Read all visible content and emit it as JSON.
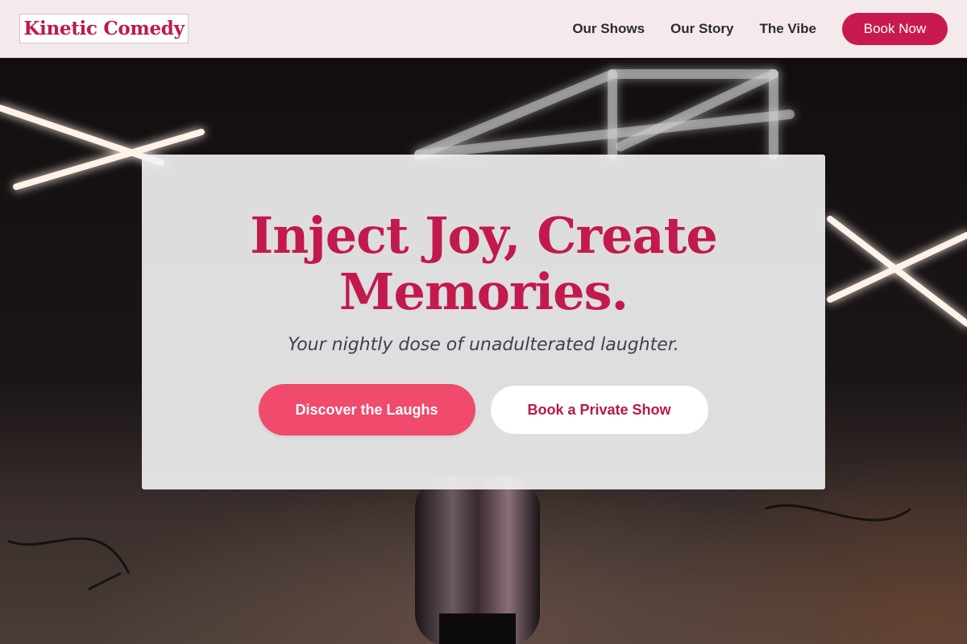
{
  "header": {
    "logo": "Kinetic Comedy",
    "nav": [
      "Our Shows",
      "Our Story",
      "The Vibe"
    ],
    "cta": "Book Now"
  },
  "hero": {
    "headline": "Inject Joy, Create Memories.",
    "tagline": "Your nightly dose of unadulterated laughter.",
    "primary_button": "Discover the Laughs",
    "secondary_button": "Book a Private Show",
    "background_image": "comedy-stage-microphone-neon-lights"
  },
  "colors": {
    "accent": "#c81a4e",
    "primary_button": "#f04a6c",
    "header_bg": "#f4eaec",
    "headline": "#c21a4c"
  }
}
